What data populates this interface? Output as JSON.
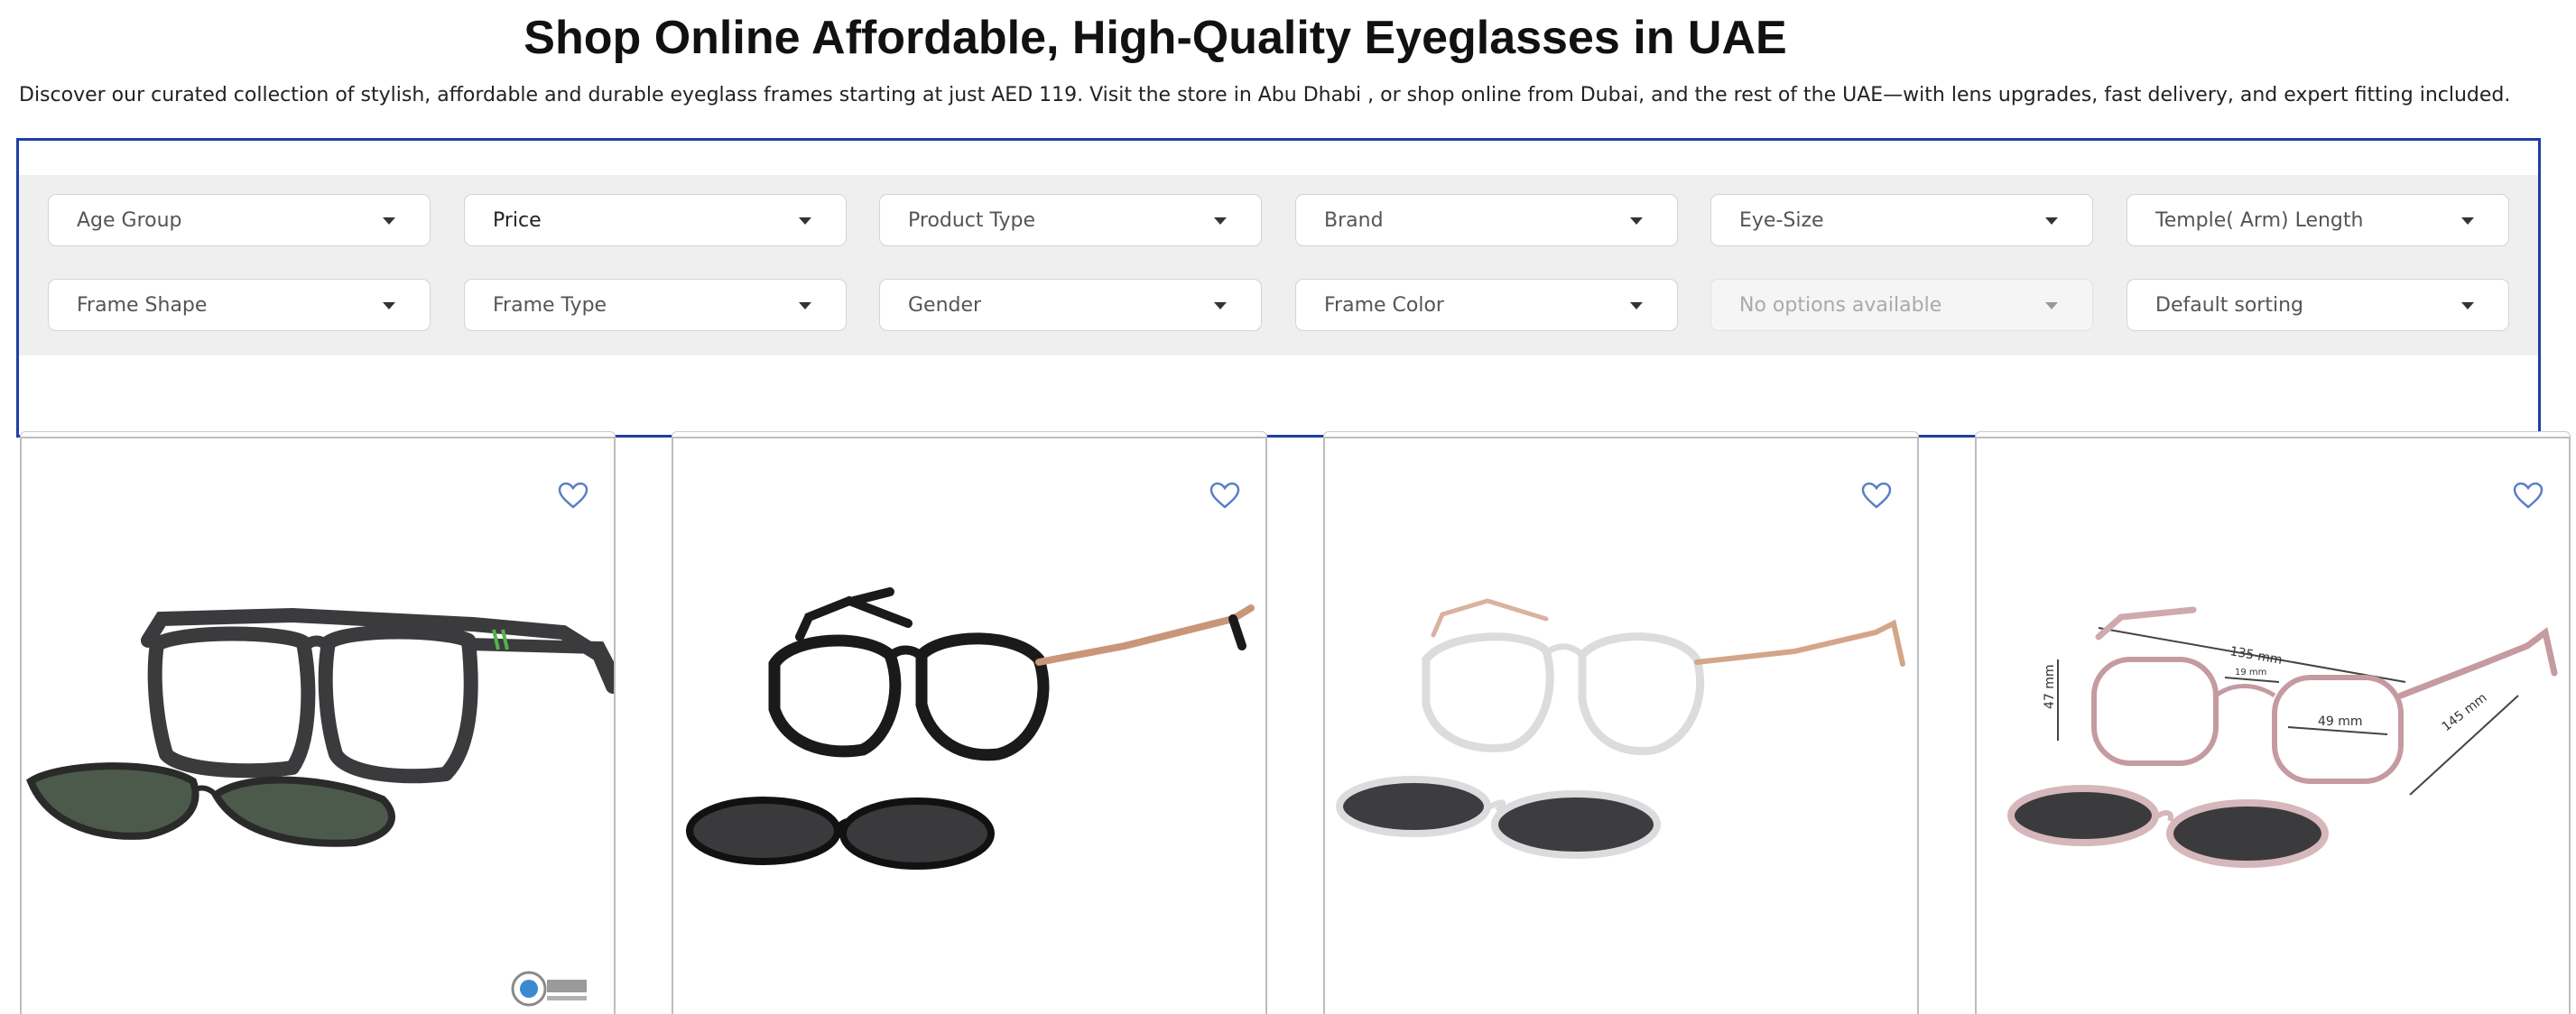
{
  "header": {
    "title": "Shop Online Affordable, High-Quality Eyeglasses in UAE",
    "description": "Discover our curated collection of stylish, affordable  and durable eyeglass frames starting at just AED 119. Visit the store in Abu Dhabi , or shop online from Dubai, and the rest of the UAE—with lens upgrades, fast delivery, and expert fitting included."
  },
  "filters": {
    "row1": [
      {
        "label": "Age Group"
      },
      {
        "label": "Price"
      },
      {
        "label": "Product Type"
      },
      {
        "label": "Brand"
      },
      {
        "label": "Eye-Size"
      },
      {
        "label": "Temple( Arm) Length"
      }
    ],
    "row2": [
      {
        "label": "Frame Shape"
      },
      {
        "label": "Frame Type"
      },
      {
        "label": "Gender"
      },
      {
        "label": "Frame Color"
      },
      {
        "label": "No options available"
      },
      {
        "label": "Default sorting"
      }
    ]
  },
  "products": [
    {
      "image": "black-rectangle-eyeglasses-with-green-clip-on-sunglasses",
      "wishlist_icon": "heart-outline-icon",
      "badge": "optic-one-opticals-logo"
    },
    {
      "image": "black-cat-eye-eyeglasses-with-rose-gold-temples-and-clip-on",
      "wishlist_icon": "heart-outline-icon"
    },
    {
      "image": "clear-cat-eye-eyeglasses-with-clip-on-sunglasses",
      "wishlist_icon": "heart-outline-icon"
    },
    {
      "image": "pink-metal-eyeglasses-with-measurements-and-clip-on",
      "wishlist_icon": "heart-outline-icon",
      "measurements": {
        "width": "135 mm",
        "bridge": "19 mm",
        "lens": "49 mm",
        "height": "47 mm",
        "temple": "145 mm"
      }
    }
  ],
  "colors": {
    "filter_frame_border": "#1d3fa6",
    "filter_bar_bg": "#efefef",
    "heart": "#5b7fc6"
  }
}
